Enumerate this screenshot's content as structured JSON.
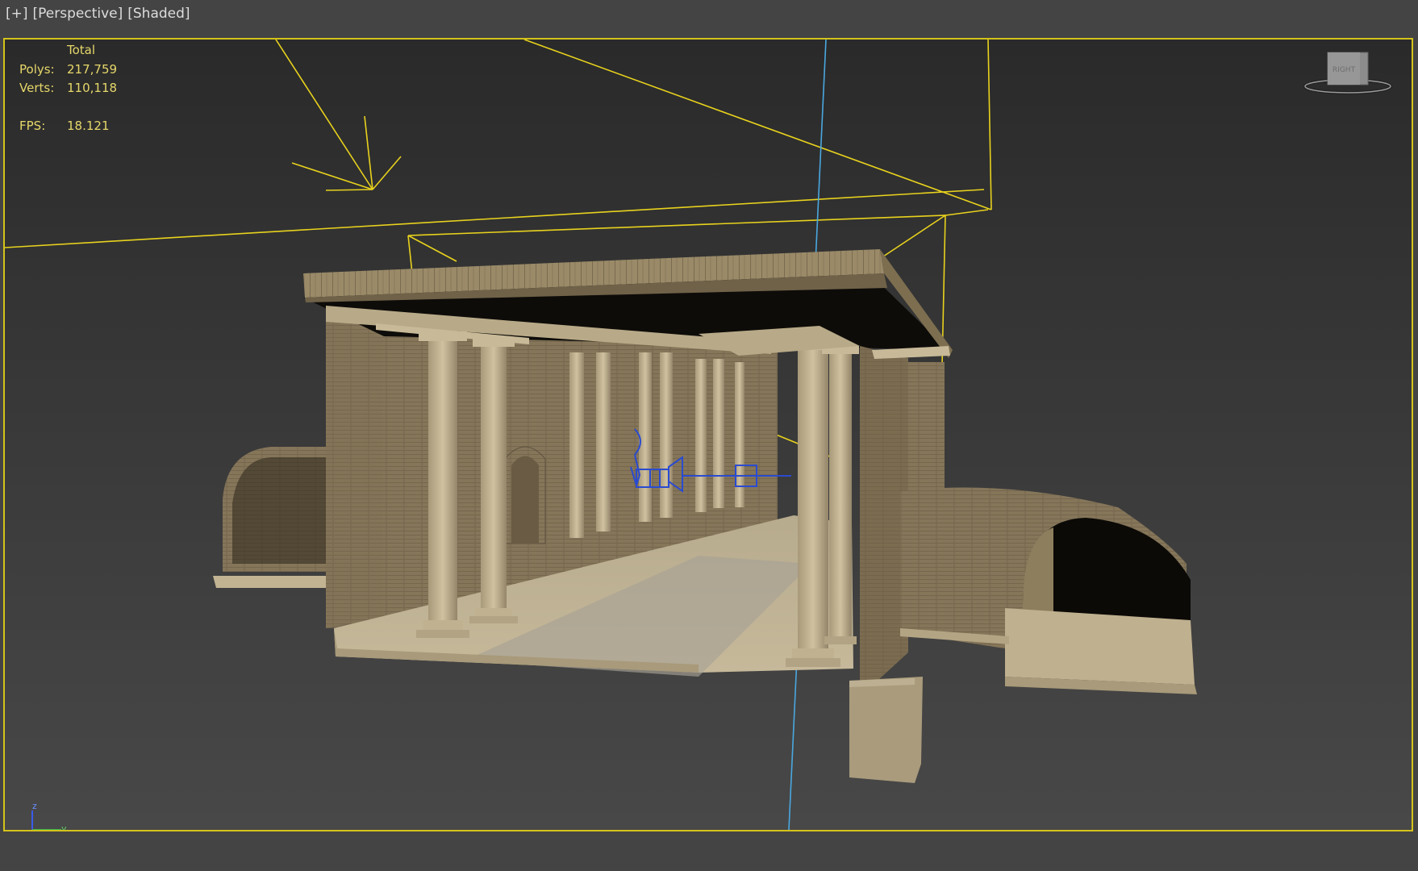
{
  "viewport": {
    "labels": [
      "[+]",
      "[Perspective]",
      "[Shaded]"
    ],
    "border_color": "#d4c31a"
  },
  "stats": {
    "header": "Total",
    "rows": [
      {
        "key": "Polys:",
        "value": "217,759"
      },
      {
        "key": "Verts:",
        "value": "110,118"
      }
    ],
    "fps_key": "FPS:",
    "fps_value": "18.121",
    "color": "#e6d76a"
  },
  "viewcube": {
    "face_label": "RIGHT",
    "icon": "viewcube-icon"
  },
  "axis_tripod": {
    "z": "z",
    "y": "y",
    "icon": "axis-tripod-icon"
  },
  "scene": {
    "description_icons": [
      "temple-model-icon",
      "camera-icon",
      "light-icon"
    ],
    "wireframe_color": "#e8d21d",
    "camera_color": "#2a4bd0",
    "axis_line_color": "#4aa8e0"
  }
}
